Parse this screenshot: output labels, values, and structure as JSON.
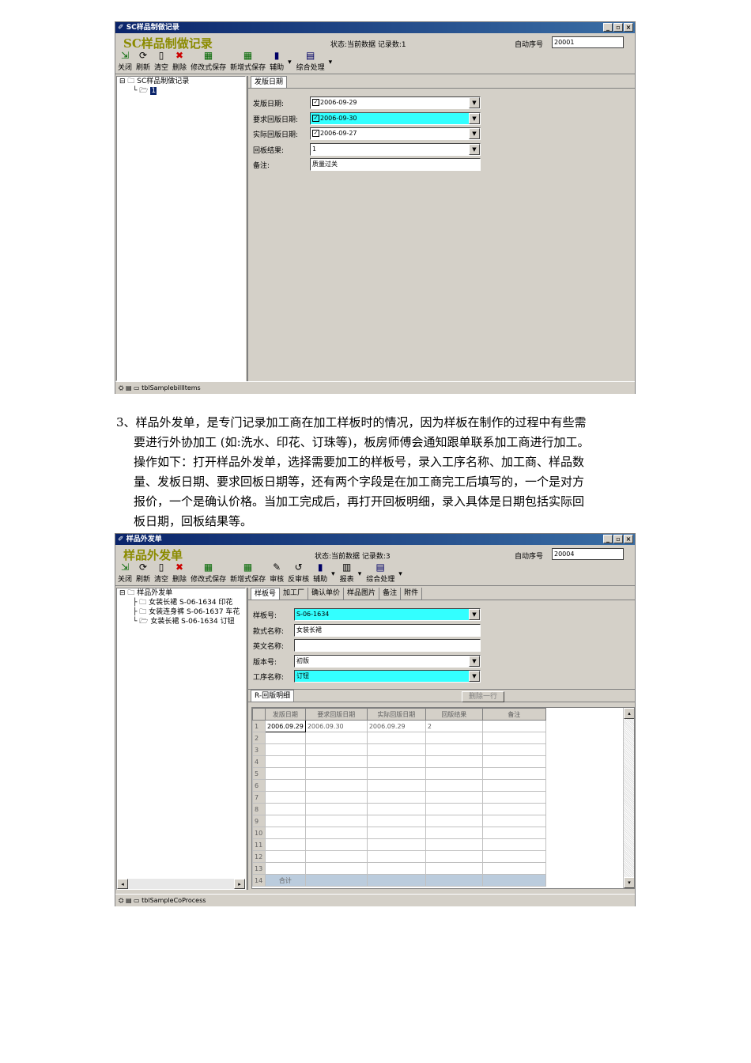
{
  "window1": {
    "title": "SC样品制做记录",
    "header_title": "SC样品制做记录",
    "status": "状态:当前数据 记录数:1",
    "seq_label": "自动序号",
    "seq_value": "20001",
    "toolbar": [
      {
        "icon": "exit-icon",
        "glyph": "⇲",
        "label": "关闭",
        "dropdown": false
      },
      {
        "icon": "refresh-icon",
        "glyph": "⟳",
        "label": "刷新",
        "dropdown": false
      },
      {
        "icon": "new-doc-icon",
        "glyph": "▯",
        "label": "清空",
        "dropdown": false
      },
      {
        "icon": "delete-icon",
        "glyph": "✖",
        "label": "删除",
        "dropdown": false
      },
      {
        "icon": "save-icon",
        "glyph": "▦",
        "label": "修改式保存",
        "dropdown": false
      },
      {
        "icon": "save-new-icon",
        "glyph": "▦",
        "label": "新增式保存",
        "dropdown": false
      },
      {
        "icon": "assist-icon",
        "glyph": "▮",
        "label": "辅助",
        "dropdown": true
      },
      {
        "icon": "process-icon",
        "glyph": "▤",
        "label": "综合处理",
        "dropdown": true
      }
    ],
    "tree_root": "SC样品制做记录",
    "tree_child": "1",
    "tab": "发版日期",
    "fields": [
      {
        "label": "发版日期:",
        "value": "2006-09-29",
        "checked": true,
        "highlight": false,
        "dropdown": true
      },
      {
        "label": "要求回版日期:",
        "value": "2006-09-30",
        "checked": true,
        "highlight": true,
        "dropdown": true
      },
      {
        "label": "实际回版日期:",
        "value": "2006-09-27",
        "checked": true,
        "highlight": false,
        "dropdown": true
      },
      {
        "label": "回板结果:",
        "value": "1",
        "checked": false,
        "highlight": false,
        "dropdown": true
      },
      {
        "label": "备注:",
        "value": "质量过关",
        "checked": false,
        "highlight": false,
        "dropdown": false
      }
    ],
    "statusbar": "tblSamplebillItems"
  },
  "paragraph": {
    "lines": [
      "3、样品外发单，是专门记录加工商在加工样板时的情况，因为样板在制作的过程中有些需",
      "要进行外协加工 (如:洗水、印花、订珠等)，板房师傅会通知跟单联系加工商进行加工。",
      "操作如下：打开样品外发单，选择需要加工的样板号，录入工序名称、加工商、样品数",
      "量、发板日期、要求回板日期等，还有两个字段是在加工商完工后填写的，一个是对方",
      "报价，一个是确认价格。当加工完成后，再打开回板明细，录入具体是日期包括实际回",
      "板日期，回板结果等。"
    ]
  },
  "window2": {
    "title": "样品外发单",
    "header_title": "样品外发单",
    "status": "状态:当前数据 记录数:3",
    "seq_label": "自动序号",
    "seq_value": "20004",
    "toolbar": [
      {
        "icon": "exit-icon",
        "glyph": "⇲",
        "label": "关闭",
        "dropdown": false
      },
      {
        "icon": "refresh-icon",
        "glyph": "⟳",
        "label": "刷新",
        "dropdown": false
      },
      {
        "icon": "new-doc-icon",
        "glyph": "▯",
        "label": "清空",
        "dropdown": false
      },
      {
        "icon": "delete-icon",
        "glyph": "✖",
        "label": "删除",
        "dropdown": false
      },
      {
        "icon": "save-icon",
        "glyph": "▦",
        "label": "修改式保存",
        "dropdown": false
      },
      {
        "icon": "save-new-icon",
        "glyph": "▦",
        "label": "新增式保存",
        "dropdown": false
      },
      {
        "icon": "audit-icon",
        "glyph": "✎",
        "label": "审核",
        "dropdown": false
      },
      {
        "icon": "unaudit-icon",
        "glyph": "↺",
        "label": "反审核",
        "dropdown": false
      },
      {
        "icon": "assist-icon",
        "glyph": "▮",
        "label": "辅助",
        "dropdown": true
      },
      {
        "icon": "report-icon",
        "glyph": "▥",
        "label": "报表",
        "dropdown": true
      },
      {
        "icon": "process-icon",
        "glyph": "▤",
        "label": "综合处理",
        "dropdown": true
      }
    ],
    "tree_root": "样品外发单",
    "tree_children": [
      "女装长裙 S-06-1634 印花",
      "女装连身裤 S-06-1637 车花",
      "女装长裙 S-06-1634 订钮"
    ],
    "tabs": [
      "样板号",
      "加工厂",
      "确认单价",
      "样品图片",
      "备注",
      "附件"
    ],
    "fields": [
      {
        "label": "样板号:",
        "value": "S-06-1634",
        "highlight": true,
        "dropdown": true
      },
      {
        "label": "款式名称:",
        "value": "女装长裙",
        "highlight": false,
        "dropdown": false
      },
      {
        "label": "英文名称:",
        "value": "",
        "highlight": false,
        "dropdown": false
      },
      {
        "label": "版本号:",
        "value": "初版",
        "highlight": false,
        "dropdown": true
      },
      {
        "label": "工序名称:",
        "value": "订钮",
        "highlight": true,
        "dropdown": true
      }
    ],
    "detail_tab": "R-回版明细",
    "delete_row": "删除一行",
    "grid_headers": [
      "发版日期",
      "要求回版日期",
      "实际回版日期",
      "回版结果",
      "备注"
    ],
    "grid_rows": [
      [
        "1",
        "2006.09.29",
        "2006.09.30",
        "2006.09.29",
        "2",
        ""
      ],
      [
        "2",
        "",
        "",
        "",
        "",
        ""
      ],
      [
        "3",
        "",
        "",
        "",
        "",
        ""
      ],
      [
        "4",
        "",
        "",
        "",
        "",
        ""
      ],
      [
        "5",
        "",
        "",
        "",
        "",
        ""
      ],
      [
        "6",
        "",
        "",
        "",
        "",
        ""
      ],
      [
        "7",
        "",
        "",
        "",
        "",
        ""
      ],
      [
        "8",
        "",
        "",
        "",
        "",
        ""
      ],
      [
        "9",
        "",
        "",
        "",
        "",
        ""
      ],
      [
        "10",
        "",
        "",
        "",
        "",
        ""
      ],
      [
        "11",
        "",
        "",
        "",
        "",
        ""
      ],
      [
        "12",
        "",
        "",
        "",
        "",
        ""
      ],
      [
        "13",
        "",
        "",
        "",
        "",
        ""
      ],
      [
        "14",
        "合计",
        "",
        "",
        "",
        ""
      ]
    ],
    "statusbar": "tblSampleCoProcess"
  }
}
